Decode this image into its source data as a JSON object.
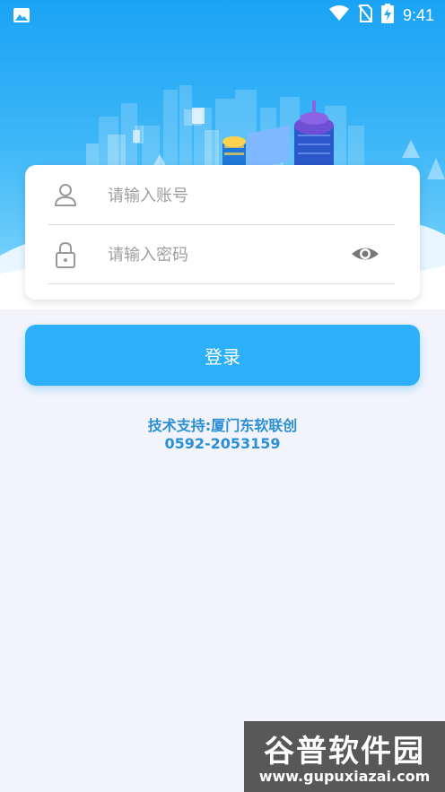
{
  "status_bar": {
    "time": "9:41",
    "icons": [
      "image-icon",
      "wifi-icon",
      "no-sim-icon",
      "battery-charging-icon"
    ]
  },
  "login_form": {
    "account_placeholder": "请输入账号",
    "password_placeholder": "请输入密码",
    "account_icon": "user-icon",
    "password_icon": "lock-icon",
    "toggle_icon": "eye-icon",
    "login_label": "登录"
  },
  "support": {
    "line1": "技术支持:厦门东软联创",
    "line2": "0592-2053159"
  },
  "watermark": {
    "title": "谷普软件园",
    "url": "www.gupuxiazai.com"
  },
  "colors": {
    "primary": "#2bb0f9",
    "support_text": "#2a8fd6",
    "background": "#f3f4fb"
  }
}
